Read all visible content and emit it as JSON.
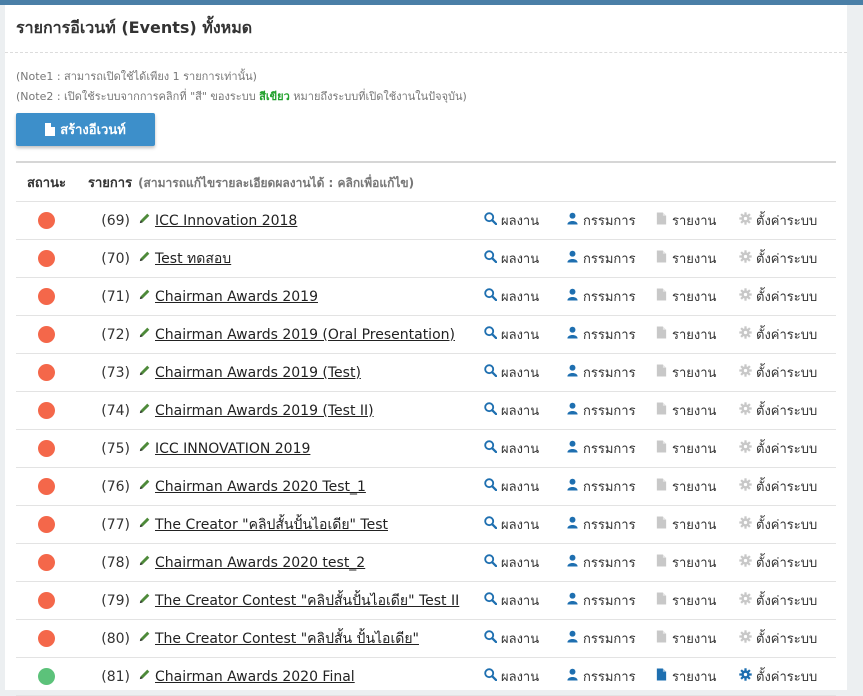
{
  "title": "รายการอีเวนท์ (Events) ทั้งหมด",
  "notes": {
    "note1": "(Note1 : สามารถเปิดใช้ได้เพียง 1 รายการเท่านั้น)",
    "note2_prefix": "(Note2 : เปิดใช้ระบบจากการคลิกที่ \"สี\" ของระบบ ",
    "note2_green": "สีเขียว",
    "note2_suffix": " หมายถึงระบบที่เปิดใช้งานในปัจจุบัน)"
  },
  "create_button": "สร้างอีเวนท์",
  "table": {
    "col_status": "สถานะ",
    "col_item": "รายการ",
    "col_item_note": "(สามารถแก้ไขรายละเอียดผลงานได้ : คลิกเพื่อแก้ไข)",
    "action_labels": {
      "results": "ผลงาน",
      "committee": "กรรมการ",
      "report": "รายงาน",
      "settings": "ตั้งค่าระบบ"
    },
    "rows": [
      {
        "num": "(69)",
        "name": "ICC Innovation 2018",
        "active": false
      },
      {
        "num": "(70)",
        "name": "Test ทดสอบ",
        "active": false
      },
      {
        "num": "(71)",
        "name": "Chairman Awards 2019",
        "active": false
      },
      {
        "num": "(72)",
        "name": "Chairman Awards 2019 (Oral Presentation)",
        "active": false
      },
      {
        "num": "(73)",
        "name": "Chairman Awards 2019 (Test)",
        "active": false
      },
      {
        "num": "(74)",
        "name": "Chairman Awards 2019 (Test II)",
        "active": false
      },
      {
        "num": "(75)",
        "name": "ICC INNOVATION 2019",
        "active": false
      },
      {
        "num": "(76)",
        "name": "Chairman Awards 2020 Test_1",
        "active": false
      },
      {
        "num": "(77)",
        "name": "The Creator \"คลิปสั้นปั้นไอเดีย\" Test",
        "active": false
      },
      {
        "num": "(78)",
        "name": "Chairman Awards 2020 test_2",
        "active": false
      },
      {
        "num": "(79)",
        "name": "The Creator Contest \"คลิปสั้นปั้นไอเดีย\" Test II",
        "active": false
      },
      {
        "num": "(80)",
        "name": "The Creator Contest \"คลิปสั้น ปั้นไอเดีย\"",
        "active": false
      },
      {
        "num": "(81)",
        "name": "Chairman Awards 2020 Final",
        "active": true
      }
    ]
  },
  "colors": {
    "inactive_status": "#f4674a",
    "active_status": "#5cc27a",
    "primary": "#3d8fca",
    "accent_icon": "#1e6fb0",
    "muted_icon": "#c8c8c8"
  },
  "icons": {
    "results": "search-icon",
    "committee": "user-icon",
    "report": "file-icon",
    "settings": "gear-icon",
    "edit": "pencil-icon"
  }
}
